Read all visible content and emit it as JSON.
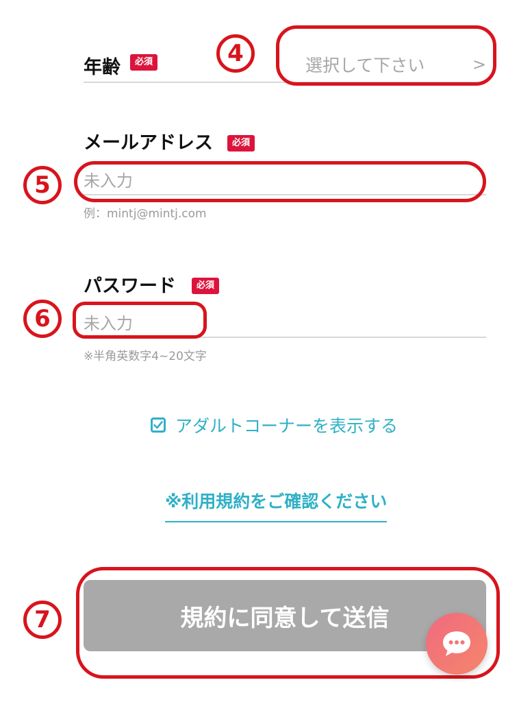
{
  "age_field": {
    "label": "年齢",
    "required_badge": "必須",
    "select_placeholder": "選択して下さい",
    "chevron": ">",
    "step_marker": "4"
  },
  "email_field": {
    "label": "メールアドレス",
    "required_badge": "必須",
    "placeholder": "未入力",
    "hint": "例：mintj@mintj.com",
    "step_marker": "5"
  },
  "password_field": {
    "label": "パスワード",
    "required_badge": "必須",
    "placeholder": "未入力",
    "hint": "※半角英数字4~20文字",
    "step_marker": "6"
  },
  "adult_toggle": {
    "label": "アダルトコーナーを表示する",
    "checked": true
  },
  "terms_link": {
    "label": "※利用規約をご確認ください"
  },
  "submit": {
    "label": "規約に同意して送信",
    "step_marker": "7"
  },
  "icons": {
    "checkbox": "check-icon",
    "chat": "chat-bubble-icon",
    "chevron": "chevron-right-icon"
  },
  "colors": {
    "annotation_red": "#d8141c",
    "badge_red": "#dc143c",
    "accent_teal": "#2fb0c6",
    "submit_gray": "#a9a9a9",
    "chat_gradient_start": "#f06a7f",
    "chat_gradient_end": "#f5866b"
  }
}
